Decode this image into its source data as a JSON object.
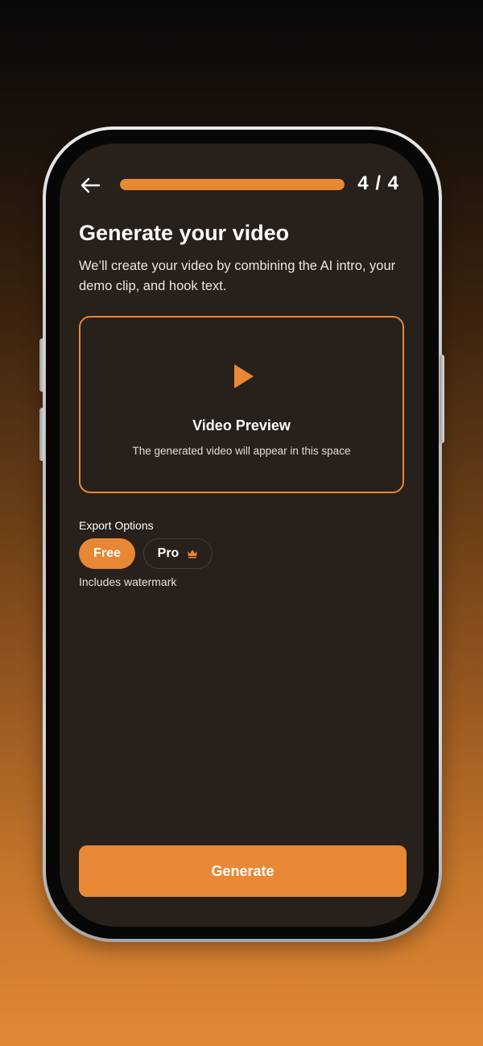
{
  "header": {
    "step_label": "4 / 4",
    "progress_fraction": 1.0
  },
  "page": {
    "title": "Generate your video",
    "subtitle": "We’ll create your video by combining the AI intro, your demo clip, and hook text."
  },
  "preview": {
    "icon": "play-icon",
    "title": "Video Preview",
    "subtitle": "The generated video will appear in this space"
  },
  "export": {
    "label": "Export Options",
    "options": [
      {
        "label": "Free",
        "selected": true
      },
      {
        "label": "Pro",
        "selected": false,
        "icon": "crown-icon"
      }
    ],
    "note": "Includes watermark"
  },
  "actions": {
    "generate_label": "Generate"
  },
  "colors": {
    "accent": "#e88734",
    "screen_bg": "#27201b",
    "text": "#ffffff"
  }
}
